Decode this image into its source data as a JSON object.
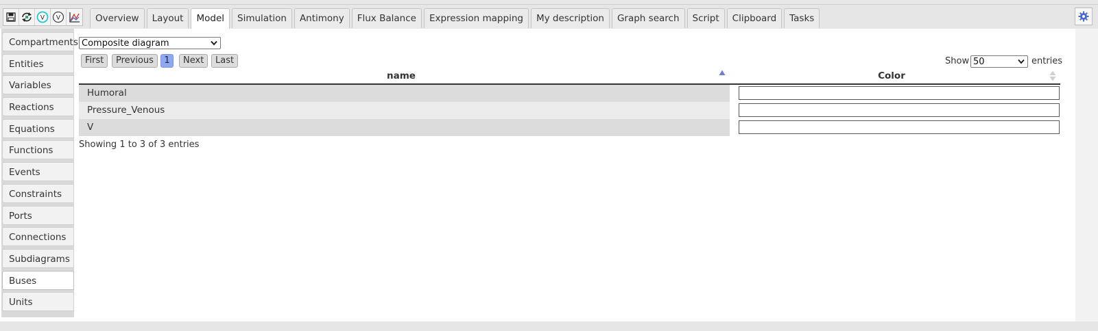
{
  "toolbar": {
    "icons": [
      "save-icon",
      "refresh-icon",
      "validate-icon",
      "validate-outline-icon",
      "plot-icon"
    ],
    "tabs": [
      "Overview",
      "Layout",
      "Model",
      "Simulation",
      "Antimony",
      "Flux Balance",
      "Expression mapping",
      "My description",
      "Graph search",
      "Script",
      "Clipboard",
      "Tasks"
    ],
    "active_tab": "Model",
    "settings_icon": "gear-icon"
  },
  "sidebar": {
    "items": [
      "Compartments",
      "Entities",
      "Variables",
      "Reactions",
      "Equations",
      "Functions",
      "Events",
      "Constraints",
      "Ports",
      "Connections",
      "Subdiagrams",
      "Buses",
      "Units"
    ],
    "active": "Buses"
  },
  "diagram_select": {
    "value": "Composite diagram"
  },
  "pagination": {
    "first": "First",
    "previous": "Previous",
    "current": "1",
    "next": "Next",
    "last": "Last"
  },
  "length_menu": {
    "show_label": "Show",
    "value": "50",
    "entries_label": "entries"
  },
  "table": {
    "columns": [
      "name",
      "Color"
    ],
    "rows": [
      {
        "name": "Humoral",
        "color": ""
      },
      {
        "name": "Pressure_Venous",
        "color": ""
      },
      {
        "name": "V",
        "color": ""
      }
    ],
    "row_colors": [
      "#dcdcdc",
      "#ececec",
      "#dcdcdc"
    ]
  },
  "info": "Showing 1 to 3 of 3 entries"
}
